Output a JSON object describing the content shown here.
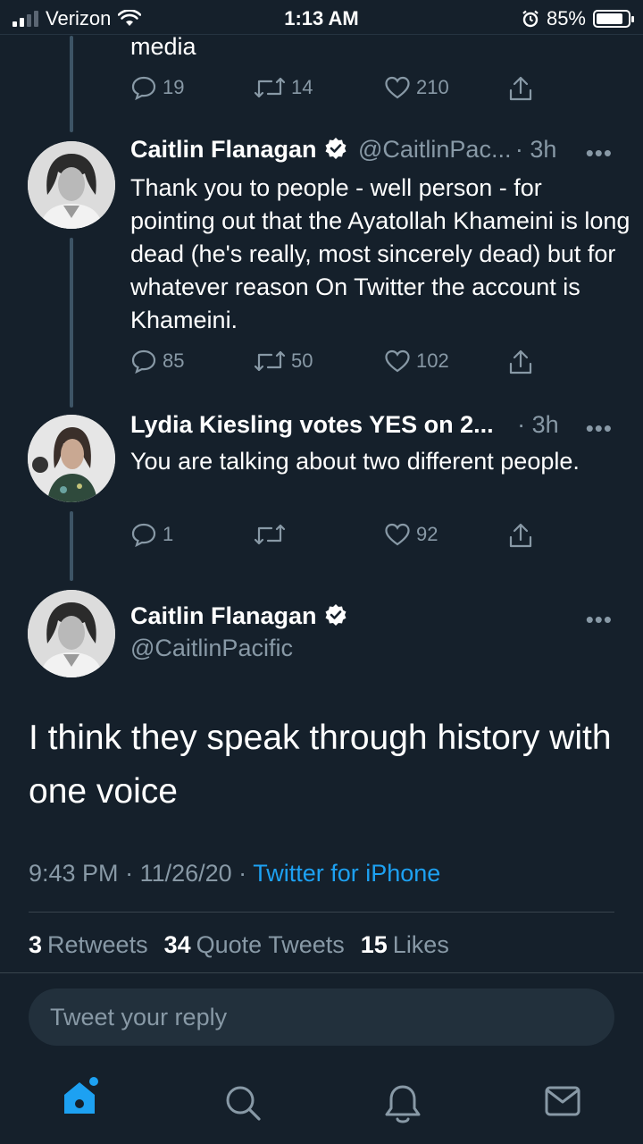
{
  "status_bar": {
    "carrier": "Verizon",
    "time": "1:13 AM",
    "battery": "85%",
    "battery_level": 0.85,
    "icons": [
      "signal-icon",
      "wifi-icon",
      "alarm-icon",
      "battery-icon"
    ]
  },
  "prev_tweet": {
    "text_tail": "media",
    "actions": {
      "replies": "19",
      "retweets": "14",
      "likes": "210"
    }
  },
  "tweet1": {
    "name": "Caitlin Flanagan",
    "handle": "@CaitlinPac...",
    "time": "· 3h",
    "text": "Thank you to people - well person - for pointing out that the Ayatollah Khameini is long dead (he's really, most sincerely dead) but for whatever reason On Twitter the account is Khameini.",
    "actions": {
      "replies": "85",
      "retweets": "50",
      "likes": "102"
    }
  },
  "tweet2": {
    "name": "Lydia Kiesling votes YES on 2...",
    "time": "· 3h",
    "text": "You are talking about two different people.",
    "actions": {
      "replies": "1",
      "retweets": "",
      "likes": "92"
    }
  },
  "main_tweet": {
    "name": "Caitlin Flanagan",
    "handle": "@CaitlinPacific",
    "text": "I think they speak through history with one voice",
    "time": "9:43 PM",
    "date": "11/26/20",
    "separator": " · ",
    "source": "Twitter for iPhone",
    "stats": {
      "retweets_count": "3",
      "retweets_label": "Retweets",
      "quotes_count": "34",
      "quotes_label": "Quote Tweets",
      "likes_count": "15",
      "likes_label": "Likes"
    }
  },
  "reply": {
    "placeholder": "Tweet your reply"
  },
  "colors": {
    "background": "#15202b",
    "accent": "#1da1f2",
    "secondary_text": "#8899a6"
  }
}
